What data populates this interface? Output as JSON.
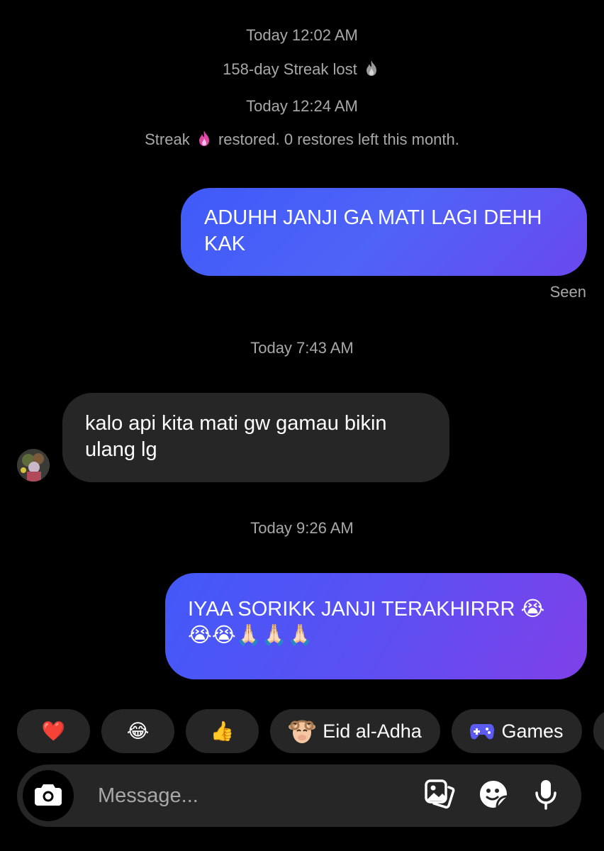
{
  "thread": {
    "events": [
      {
        "text": "Today 12:02 AM"
      },
      {
        "text_before": "158-day Streak lost",
        "icon": "grey-flame-icon"
      },
      {
        "text": "Today 12:24 AM"
      },
      {
        "text_before": "Streak",
        "icon": "pink-flame-icon",
        "text_after": "restored. 0 restores left this month."
      },
      {
        "text": "Today 7:43 AM"
      },
      {
        "text": "Today 9:26 AM"
      }
    ],
    "messages": [
      {
        "direction": "outgoing",
        "lines": [
          "ADUHH JANJI GA MATI LAGI DEHH",
          "KAK"
        ]
      },
      {
        "direction": "incoming",
        "lines": [
          "kalo api kita mati gw gamau bikin",
          "ulang lg"
        ]
      },
      {
        "direction": "outgoing",
        "lines": [
          "IYAA SORIKK JANJI TERAKHIRRR 😭",
          "😭😭🙏🏻🙏🏻🙏🏻"
        ]
      }
    ],
    "seen_label": "Seen",
    "avatar_icon": "contact-avatar"
  },
  "quick_replies": [
    {
      "emoji": "❤️",
      "icon": "heart-icon"
    },
    {
      "emoji": "😂",
      "icon": "laughing-tears-icon"
    },
    {
      "emoji": "👍",
      "icon": "thumbs-up-icon"
    },
    {
      "label": "Eid al-Adha",
      "icon": "sheep-icon"
    },
    {
      "label": "Games",
      "icon": "gamepad-icon"
    }
  ],
  "composer": {
    "placeholder": "Message...",
    "icons": [
      "camera-icon",
      "gallery-icon",
      "sticker-icon",
      "microphone-icon"
    ]
  },
  "colors": {
    "background": "#000000",
    "outgoing_bubble_start": "#3f5af8",
    "outgoing_bubble_end": "#8040e8",
    "incoming_bubble": "#262626",
    "meta_text": "#a8a8a8",
    "streak_flame": "#e048a8"
  }
}
